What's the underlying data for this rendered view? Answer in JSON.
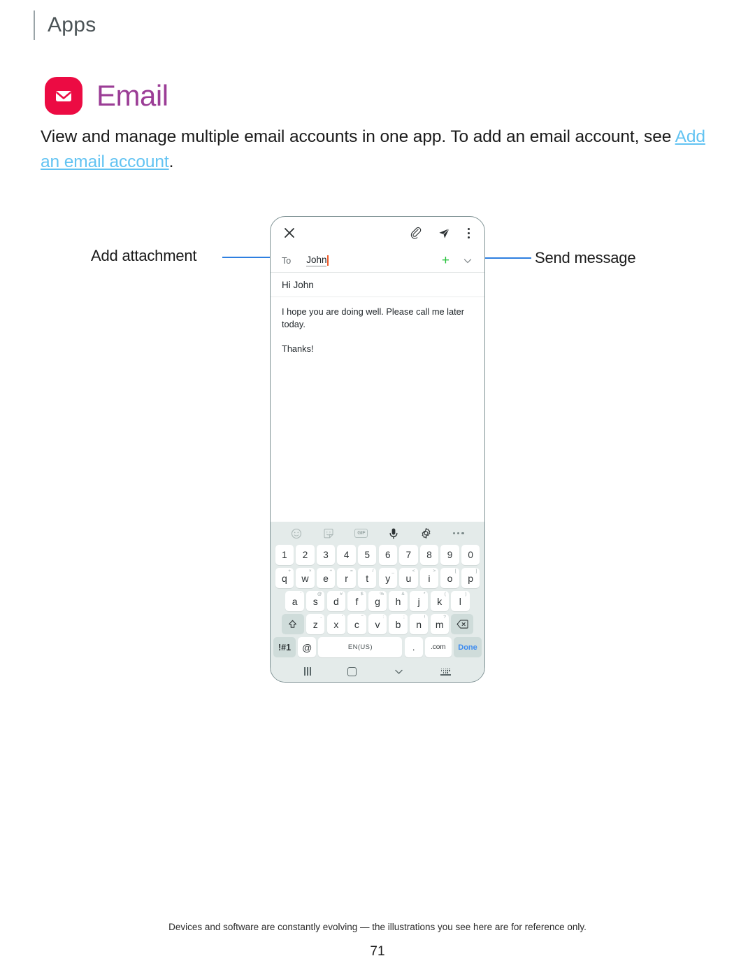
{
  "header": {
    "section_title": "Apps"
  },
  "app": {
    "name": "Email",
    "icon": "envelope-icon",
    "icon_color": "#ec0b43",
    "title_color": "#9b3d96"
  },
  "description": {
    "text_before": "View and manage multiple email accounts in one app. To add an email account, see ",
    "link_text": "Add an email account",
    "text_after": ".",
    "link_color": "#62c3f2"
  },
  "callouts": {
    "left": {
      "label": "Add attachment",
      "points_to": "attach-icon"
    },
    "right": {
      "label": "Send message",
      "points_to": "send-icon"
    },
    "line_color": "#2e7fe0"
  },
  "phone": {
    "compose": {
      "close_icon": "close-icon",
      "attach_icon": "paperclip-icon",
      "send_icon": "send-icon",
      "more_icon": "more-vertical-icon",
      "to_label": "To",
      "to_value": "John",
      "add_recipient_icon": "plus-icon",
      "add_recipient_color": "#27c23c",
      "expand_icon": "chevron-down-icon",
      "cursor_color": "#f05a28",
      "subject": "Hi John",
      "body_paragraphs": [
        "I hope you are doing well. Please call me later today.",
        "Thanks!"
      ]
    },
    "keyboard": {
      "toolbar": [
        "emoji-icon",
        "sticker-icon",
        "gif-icon",
        "microphone-icon",
        "settings-gear-icon",
        "more-horizontal-icon"
      ],
      "gif_label": "GIF",
      "number_row": [
        "1",
        "2",
        "3",
        "4",
        "5",
        "6",
        "7",
        "8",
        "9",
        "0"
      ],
      "row_q": [
        {
          "key": "q",
          "sup": "+"
        },
        {
          "key": "w",
          "sup": "×"
        },
        {
          "key": "e",
          "sup": "÷"
        },
        {
          "key": "r",
          "sup": "="
        },
        {
          "key": "t",
          "sup": "/"
        },
        {
          "key": "y",
          "sup": "_"
        },
        {
          "key": "u",
          "sup": "<"
        },
        {
          "key": "i",
          "sup": ">"
        },
        {
          "key": "o",
          "sup": "["
        },
        {
          "key": "p",
          "sup": "]"
        }
      ],
      "row_a": [
        {
          "key": "a",
          "sup": "'"
        },
        {
          "key": "s",
          "sup": "@"
        },
        {
          "key": "d",
          "sup": "#"
        },
        {
          "key": "f",
          "sup": "$"
        },
        {
          "key": "g",
          "sup": "%"
        },
        {
          "key": "h",
          "sup": "&"
        },
        {
          "key": "j",
          "sup": "*"
        },
        {
          "key": "k",
          "sup": "("
        },
        {
          "key": "l",
          "sup": ")"
        }
      ],
      "row_z": [
        {
          "key": "z",
          "sup": "-"
        },
        {
          "key": "x",
          "sup": "'"
        },
        {
          "key": "c",
          "sup": "\""
        },
        {
          "key": "v",
          "sup": ":"
        },
        {
          "key": "b",
          "sup": ";"
        },
        {
          "key": "n",
          "sup": "!"
        },
        {
          "key": "m",
          "sup": "?"
        }
      ],
      "shift_icon": "shift-arrow-icon",
      "backspace_icon": "backspace-icon",
      "symbols_key": "!#1",
      "at_key": "@",
      "space_key": "EN(US)",
      "period_key": ".",
      "dotcom_key": ".com",
      "done_key": "Done",
      "done_color": "#3d8bf0"
    },
    "navbar": {
      "recents_icon": "recents-icon",
      "home_icon": "home-icon",
      "back_icon": "chevron-down-icon",
      "hide_keyboard_icon": "hide-keyboard-icon"
    }
  },
  "footer": {
    "note": "Devices and software are constantly evolving — the illustrations you see here are for reference only.",
    "page_number": "71"
  }
}
